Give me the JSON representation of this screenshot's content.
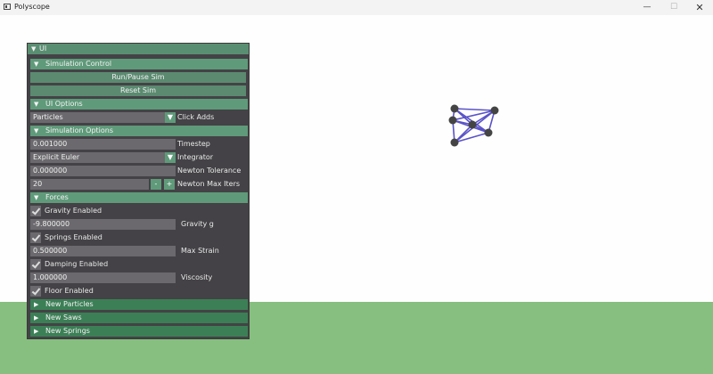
{
  "window": {
    "title": "Polyscope",
    "min_icon": "minimize-icon",
    "max_icon": "maximize-icon",
    "close_icon": "close-icon",
    "min_glyph": "—",
    "max_glyph": "☐",
    "close_glyph": "✕"
  },
  "colors": {
    "floor": "#86bf80",
    "panel": "#444246",
    "header": "#5f9a7a",
    "mesh": "#5a52c8"
  },
  "ui": {
    "header": "UI",
    "simulation_control": {
      "header": "Simulation Control",
      "run": "Run/Pause Sim",
      "reset": "Reset Sim"
    },
    "ui_options": {
      "header": "UI Options",
      "click_adds_value": "Particles",
      "click_adds_label": "Click Adds"
    },
    "simulation_options": {
      "header": "Simulation Options",
      "timestep_value": "0.001000",
      "timestep_label": "Timestep",
      "integrator_value": "Explicit Euler",
      "integrator_label": "Integrator",
      "newton_tol_value": "0.000000",
      "newton_tol_label": "Newton Tolerance",
      "newton_iters_value": "20",
      "newton_iters_label": "Newton Max Iters",
      "minus": "-",
      "plus": "+"
    },
    "forces": {
      "header": "Forces",
      "gravity_enabled": "Gravity Enabled",
      "gravity_value": "-9.800000",
      "gravity_label": "Gravity g",
      "springs_enabled": "Springs Enabled",
      "max_strain_value": "0.500000",
      "max_strain_label": "Max Strain",
      "damping_enabled": "Damping Enabled",
      "viscosity_value": "1.000000",
      "viscosity_label": "Viscosity",
      "floor_enabled": "Floor Enabled"
    },
    "new_particles": "New Particles",
    "new_saws": "New Saws",
    "new_springs": "New Springs",
    "expanded_glyph": "▼",
    "collapsed_glyph": "▶"
  }
}
